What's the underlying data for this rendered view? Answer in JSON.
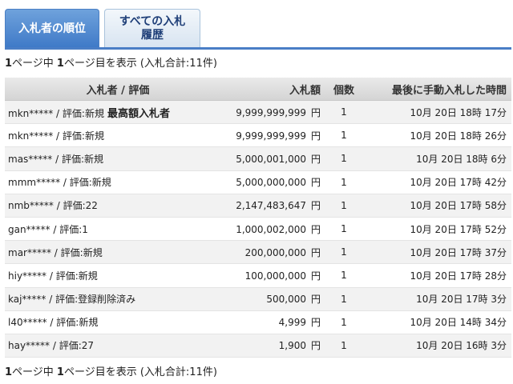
{
  "tabs": [
    {
      "label": "入札者の順位",
      "active": true
    },
    {
      "label": "すべての入札履歴",
      "active": false
    }
  ],
  "summary": {
    "page_current": "1",
    "mid1": "ページ中 ",
    "page_total": "1",
    "mid2": "ページ目を表示 (入札合計:11件)"
  },
  "table": {
    "headers": {
      "bidder": "入札者 / 評価",
      "amount": "入札額",
      "quantity": "個数",
      "time": "最後に手動入札した時間"
    },
    "currency": "円",
    "rows": [
      {
        "bidder": "mkn***** / 評価:新規",
        "badge": "最高額入札者",
        "amount": "9,999,999,999",
        "qty": "1",
        "time": "10月 20日 18時 17分"
      },
      {
        "bidder": "mkn***** / 評価:新規",
        "badge": "",
        "amount": "9,999,999,999",
        "qty": "1",
        "time": "10月 20日 18時 26分"
      },
      {
        "bidder": "mas***** / 評価:新規",
        "badge": "",
        "amount": "5,000,001,000",
        "qty": "1",
        "time": "10月 20日 18時 6分"
      },
      {
        "bidder": "mmm***** / 評価:新規",
        "badge": "",
        "amount": "5,000,000,000",
        "qty": "1",
        "time": "10月 20日 17時 42分"
      },
      {
        "bidder": "nmb***** / 評価:22",
        "badge": "",
        "amount": "2,147,483,647",
        "qty": "1",
        "time": "10月 20日 17時 58分"
      },
      {
        "bidder": "gan***** / 評価:1",
        "badge": "",
        "amount": "1,000,002,000",
        "qty": "1",
        "time": "10月 20日 17時 52分"
      },
      {
        "bidder": "mar***** / 評価:新規",
        "badge": "",
        "amount": "200,000,000",
        "qty": "1",
        "time": "10月 20日 17時 37分"
      },
      {
        "bidder": "hiy***** / 評価:新規",
        "badge": "",
        "amount": "100,000,000",
        "qty": "1",
        "time": "10月 20日 17時 28分"
      },
      {
        "bidder": "kaj***** / 評価:登録削除済み",
        "badge": "",
        "amount": "500,000",
        "qty": "1",
        "time": "10月 20日 17時 3分"
      },
      {
        "bidder": "l40***** / 評価:新規",
        "badge": "",
        "amount": "4,999",
        "qty": "1",
        "time": "10月 20日 14時 34分"
      },
      {
        "bidder": "hay***** / 評価:27",
        "badge": "",
        "amount": "1,900",
        "qty": "1",
        "time": "10月 20日 16時 3分"
      }
    ]
  },
  "colors": {
    "tab_active_bg": "#3e79c7",
    "tab_line": "#4a7ec6",
    "row_stripe": "#f2f2f2"
  }
}
